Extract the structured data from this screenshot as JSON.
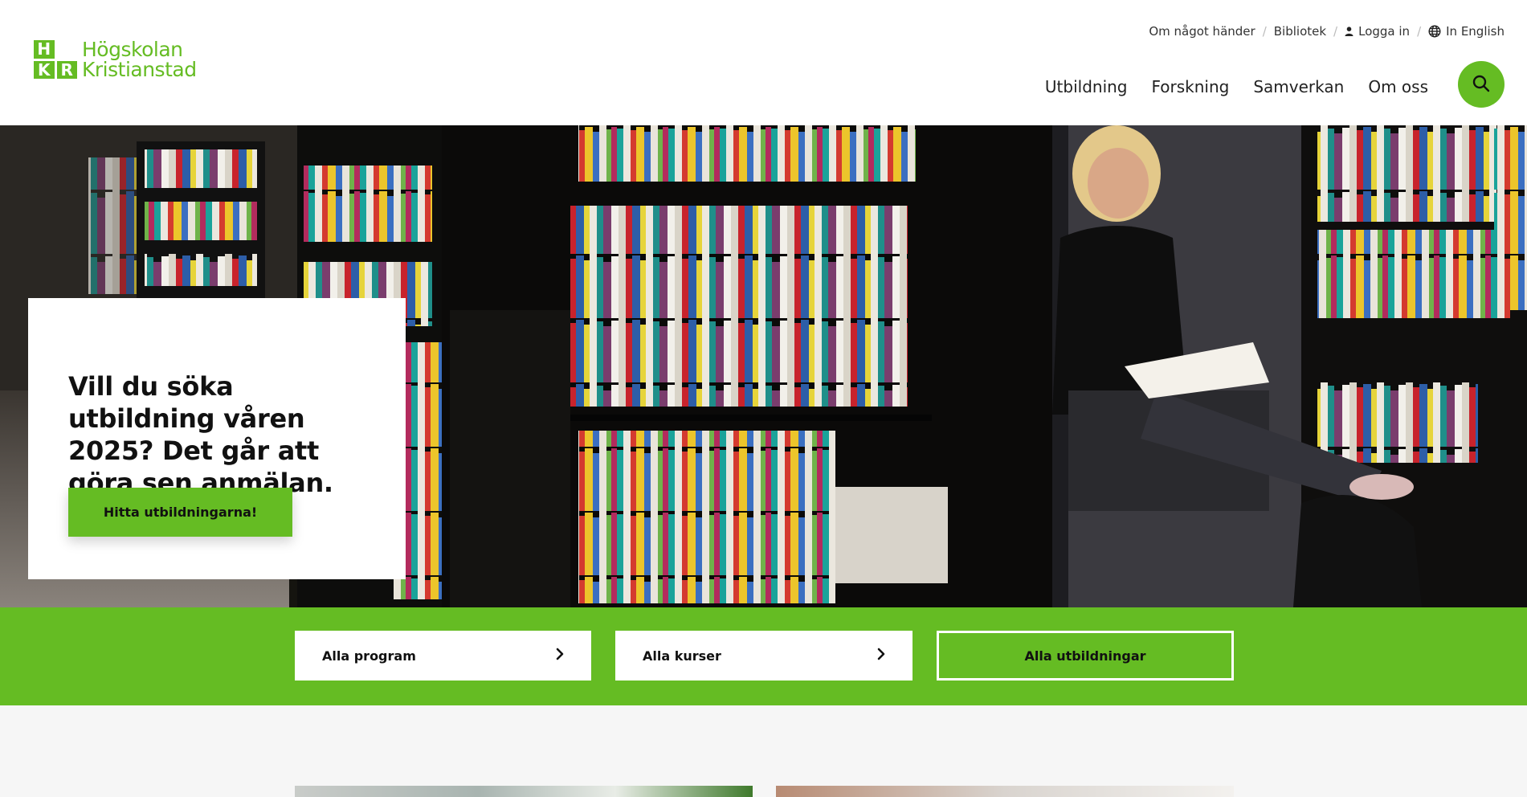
{
  "brand": {
    "logo_letters": [
      "H",
      "K",
      "K",
      "R"
    ],
    "name_line1": "Högskolan",
    "name_line2": "Kristianstad",
    "color": "#65bc23"
  },
  "utility_nav": {
    "items": [
      {
        "label": "Om något händer",
        "icon": null
      },
      {
        "label": "Bibliotek",
        "icon": null
      },
      {
        "label": "Logga in",
        "icon": "user-icon"
      },
      {
        "label": "In English",
        "icon": "globe-icon"
      }
    ],
    "separator": "/"
  },
  "main_nav": {
    "items": [
      "Utbildning",
      "Forskning",
      "Samverkan",
      "Om oss"
    ],
    "search_icon": "search-icon"
  },
  "hero": {
    "heading": "Vill du söka utbildning våren 2025? Det går att göra sen anmälan.",
    "button_label": "Hitta utbildningarna!",
    "image": "library-reader-photo"
  },
  "quick_links": {
    "program_label": "Alla program",
    "courses_label": "Alla kurser",
    "all_label": "Alla utbildningar",
    "arrow_icon": "chevron-right-icon"
  },
  "colors": {
    "accent": "#65bc23",
    "text": "#111111",
    "section_bg": "#f6f6f6"
  }
}
